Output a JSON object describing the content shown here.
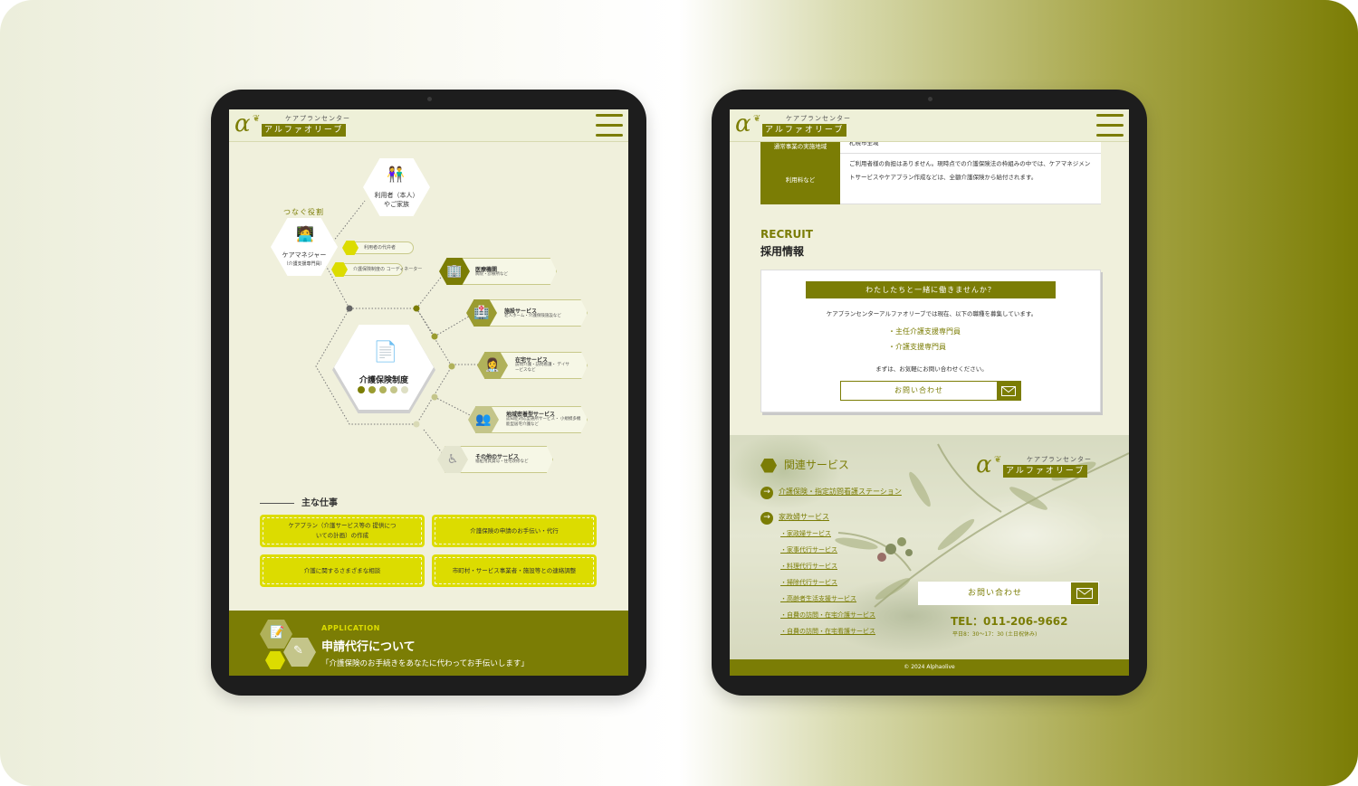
{
  "brand": {
    "prefix": "ケアプランセンター",
    "name": "アルファオリーブ",
    "alpha": "α",
    "color_primary": "#7b7d05",
    "color_accent": "#dcdc00"
  },
  "left": {
    "diagram": {
      "role_label": "つなぐ役割",
      "user_node": {
        "line1": "利用者（本人）",
        "line2": "やご家族"
      },
      "manager_node": {
        "line1": "ケアマネジャー",
        "line2": "（介護支援専門員）"
      },
      "tags": [
        "利用者の代弁者",
        "介護保険制度の コーディネーター"
      ],
      "center_node": "介護保険制度",
      "services": [
        {
          "title": "医療機関",
          "sub": "病院・診療所など",
          "icon": "building-icon"
        },
        {
          "title": "施設サービス",
          "sub": "老人ホーム・介護保険施設など",
          "icon": "facility-icon"
        },
        {
          "title": "在宅サービス",
          "sub": "訪問介護・訪問看護・ デイサービスなど",
          "icon": "nurse-icon"
        },
        {
          "title": "地域密着型サービス",
          "sub": "認知症対応型通所サービス・ 小規模多機能型居宅介護など",
          "icon": "people-icon"
        },
        {
          "title": "その他のサービス",
          "sub": "福祉用具貸与・住宅改修など",
          "icon": "wheelchair-icon"
        }
      ]
    },
    "main_work": {
      "title": "主な仕事",
      "items": [
        "ケアプラン（介護サービス等の 提供についての計画）の作成",
        "介護保険の申請のお手伝い・代行",
        "介護に関するさまざまな相談",
        "市町村・サービス事業者・施設等との連絡調整"
      ]
    },
    "application": {
      "eyebrow": "APPLICATION",
      "title": "申請代行について",
      "text": "「介護保険のお手続きをあなたに代わってお手伝いします」"
    }
  },
  "right": {
    "fee_table": {
      "top_label": "通常事業の実施地域",
      "top_value": "札幌市全域",
      "label": "利用料など",
      "value": "ご利用者様の負担はありません。現時点での介護保険法の枠組みの中では、ケアマネジメントサービスやケアプラン作成などは、全額介護保険から給付されます。"
    },
    "recruit": {
      "eyebrow": "RECRUIT",
      "title": "採用情報",
      "banner": "わたしたちと一緒に働きませんか？",
      "lead": "ケアプランセンターアルファオリーブでは現在、以下の職種を募集しています。",
      "positions": [
        "・主任介護支援専門員",
        "・介護支援専門員"
      ],
      "note": "まずは、お気軽にお問い合わせください。",
      "contact_label": "お問い合わせ"
    },
    "footer": {
      "related_title": "関連サービス",
      "main_links": [
        "介護保険・指定訪問看護ステーション",
        "家政婦サービス"
      ],
      "sub_links": [
        "・家政婦サービス",
        "・家事代行サービス",
        "・料理代行サービス",
        "・掃除代行サービス",
        "・高齢者生活支援サービス",
        "・自費の訪問・在宅介護サービス",
        "・自費の訪問・在宅看護サービス"
      ],
      "contact_label": "お問い合わせ",
      "tel": "TEL：011-206-9662",
      "hours": "平日8：30〜17：30 (土日祝休み)",
      "copyright": "© 2024 Alphaolive"
    }
  }
}
